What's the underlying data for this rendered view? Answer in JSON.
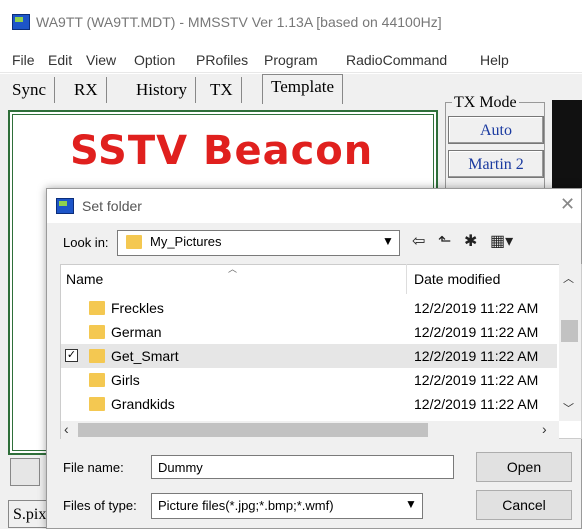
{
  "window": {
    "title": "WA9TT (WA9TT.MDT) - MMSSTV Ver 1.13A [based on 44100Hz]"
  },
  "menu": [
    "File",
    "Edit",
    "View",
    "Option",
    "PRofiles",
    "Program",
    "RadioCommand",
    "Help"
  ],
  "tabs": [
    "Sync",
    "RX",
    "History",
    "TX",
    "Template"
  ],
  "template": {
    "beacon_text": "SSTV Beacon"
  },
  "tx_mode": {
    "label": "TX Mode",
    "buttons": [
      "Auto",
      "Martin 2"
    ]
  },
  "bottom_left_label": "S.pix",
  "dialog": {
    "title": "Set folder",
    "look_in_label": "Look in:",
    "look_in_value": "My_Pictures",
    "columns": {
      "name": "Name",
      "date": "Date modified"
    },
    "files": [
      {
        "name": "Freckles",
        "date": "12/2/2019 11:22 AM",
        "selected": false
      },
      {
        "name": "German",
        "date": "12/2/2019 11:22 AM",
        "selected": false
      },
      {
        "name": "Get_Smart",
        "date": "12/2/2019 11:22 AM",
        "selected": true
      },
      {
        "name": "Girls",
        "date": "12/2/2019 11:22 AM",
        "selected": false
      },
      {
        "name": "Grandkids",
        "date": "12/2/2019 11:22 AM",
        "selected": false
      }
    ],
    "file_name_label": "File name:",
    "file_name_value": "Dummy",
    "file_type_label": "Files of type:",
    "file_type_value": "Picture files(*.jpg;*.bmp;*.wmf)",
    "open_label": "Open",
    "cancel_label": "Cancel"
  },
  "icons": {
    "back": "back-arrow-icon",
    "up": "up-folder-icon",
    "new_folder": "new-folder-icon",
    "view_menu": "view-menu-icon"
  }
}
